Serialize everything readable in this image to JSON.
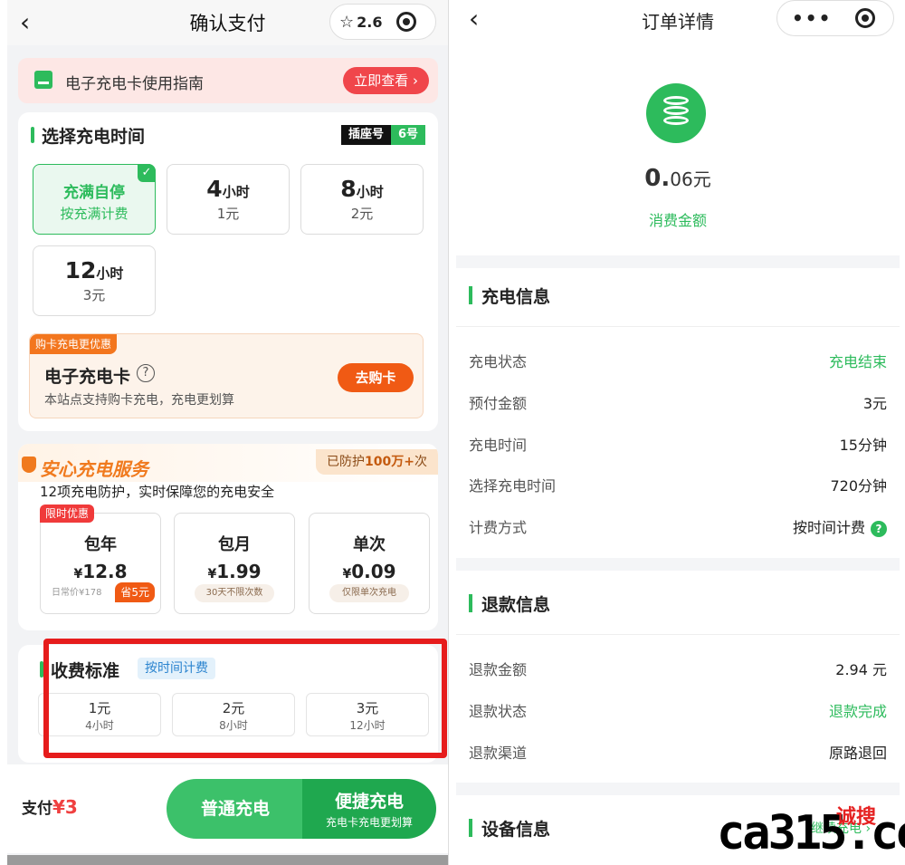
{
  "left": {
    "nav": {
      "back": "‹",
      "title": "确认支付",
      "rating": "2.6"
    },
    "guide": {
      "text": "电子充电卡使用指南",
      "button": "立即查看 ›"
    },
    "charge_time": {
      "title": "选择充电时间",
      "socket_label": "插座号",
      "socket_value": "6号",
      "options": [
        {
          "line1": "充满自停",
          "line2": "按充满计费",
          "selected": true
        },
        {
          "num": "4",
          "unit": "小时",
          "price": "1元"
        },
        {
          "num": "8",
          "unit": "小时",
          "price": "2元"
        },
        {
          "num": "12",
          "unit": "小时",
          "price": "3元"
        }
      ]
    },
    "ecard": {
      "tag": "购卡充电更优惠",
      "title": "电子充电卡",
      "desc": "本站点支持购卡充电，充电更划算",
      "button": "去购卡"
    },
    "service": {
      "title": "安心充电服务",
      "protect_prefix": "已防护",
      "protect_num": "100万+",
      "protect_suffix": "次",
      "desc": "12项充电防护，实时保障您的充电安全",
      "limited_tag": "限时优惠",
      "plans": [
        {
          "name": "包年",
          "currency": "¥",
          "price": "12.8",
          "note": "日常价¥178",
          "save": "省5元"
        },
        {
          "name": "包月",
          "currency": "¥",
          "price": "1.99",
          "note": "30天不限次数"
        },
        {
          "name": "单次",
          "currency": "¥",
          "price": "0.09",
          "note": "仅限单次充电"
        }
      ]
    },
    "fee": {
      "title": "收费标准",
      "tag": "按时间计费",
      "cells": [
        {
          "price": "1元",
          "duration": "4小时"
        },
        {
          "price": "2元",
          "duration": "8小时"
        },
        {
          "price": "3元",
          "duration": "12小时"
        }
      ]
    },
    "bottom": {
      "pay_label": "支付",
      "pay_currency": "¥",
      "pay_amount": "3",
      "normal_btn": "普通充电",
      "quick_btn": "便捷充电",
      "quick_sub": "充电卡充电更划算"
    }
  },
  "right": {
    "nav": {
      "back": "‹",
      "title": "订单详情"
    },
    "amount_main": "0.",
    "amount_rest": "06元",
    "amount_label": "消费金额",
    "charge_info": {
      "title": "充电信息",
      "rows": [
        {
          "k": "充电状态",
          "v": "充电结束"
        },
        {
          "k": "预付金额",
          "v": "3元"
        },
        {
          "k": "充电时间",
          "v": "15分钟"
        },
        {
          "k": "选择充电时间",
          "v": "720分钟"
        },
        {
          "k": "计费方式",
          "v": "按时间计费"
        }
      ]
    },
    "refund_info": {
      "title": "退款信息",
      "rows": [
        {
          "k": "退款金额",
          "v": "2.94 元"
        },
        {
          "k": "退款状态",
          "v": "退款完成"
        },
        {
          "k": "退款渠道",
          "v": "原路退回"
        }
      ]
    },
    "device_info": {
      "title": "设备信息",
      "partial": "继续充电 ›"
    }
  },
  "watermark": {
    "latin": "ca315.com",
    "cn": "诚搜"
  }
}
